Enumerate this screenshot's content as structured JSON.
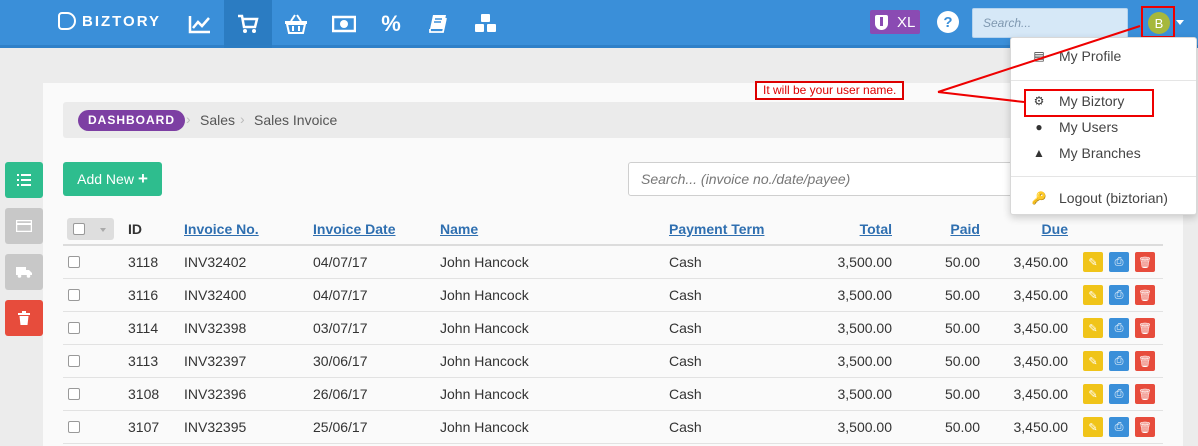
{
  "app": {
    "brand": "BIZTORY",
    "badge_label": "XL",
    "help_label": "?",
    "search_placeholder": "Search...",
    "avatar_initial": "B"
  },
  "nav_icons": [
    "chart-line-icon",
    "shopping-cart-icon",
    "basket-icon",
    "money-icon",
    "percent-icon",
    "book-icon",
    "cubes-icon"
  ],
  "dropdown": {
    "items": [
      {
        "label": "My Profile",
        "icon": "id-card-icon"
      },
      {
        "label": "My Biztory",
        "icon": "cogs-icon"
      },
      {
        "label": "My Users",
        "icon": "users-icon"
      },
      {
        "label": "My Branches",
        "icon": "sitemap-icon"
      },
      {
        "label": "Logout (biztorian)",
        "icon": "key-icon"
      }
    ]
  },
  "annotation": {
    "text": "It will be your user name.",
    "color": "#dd0000"
  },
  "breadcrumb": {
    "root": "DASHBOARD",
    "items": [
      "Sales",
      "Sales Invoice"
    ]
  },
  "toolbar": {
    "add_label": "Add New",
    "add_icon": "plus-icon",
    "search_placeholder": "Search... (invoice no./date/payee)"
  },
  "table": {
    "columns": [
      "ID",
      "Invoice No.",
      "Invoice Date",
      "Name",
      "Payment Term",
      "Total",
      "Paid",
      "Due"
    ],
    "rows": [
      {
        "id": "3118",
        "invoice": "INV32402",
        "date": "04/07/17",
        "name": "John Hancock",
        "term": "Cash",
        "total": "3,500.00",
        "paid": "50.00",
        "due": "3,450.00"
      },
      {
        "id": "3116",
        "invoice": "INV32400",
        "date": "04/07/17",
        "name": "John Hancock",
        "term": "Cash",
        "total": "3,500.00",
        "paid": "50.00",
        "due": "3,450.00"
      },
      {
        "id": "3114",
        "invoice": "INV32398",
        "date": "03/07/17",
        "name": "John Hancock",
        "term": "Cash",
        "total": "3,500.00",
        "paid": "50.00",
        "due": "3,450.00"
      },
      {
        "id": "3113",
        "invoice": "INV32397",
        "date": "30/06/17",
        "name": "John Hancock",
        "term": "Cash",
        "total": "3,500.00",
        "paid": "50.00",
        "due": "3,450.00"
      },
      {
        "id": "3108",
        "invoice": "INV32396",
        "date": "26/06/17",
        "name": "John Hancock",
        "term": "Cash",
        "total": "3,500.00",
        "paid": "50.00",
        "due": "3,450.00"
      },
      {
        "id": "3107",
        "invoice": "INV32395",
        "date": "25/06/17",
        "name": "John Hancock",
        "term": "Cash",
        "total": "3,500.00",
        "paid": "50.00",
        "due": "3,450.00"
      }
    ]
  },
  "side_actions": [
    {
      "icon": "list-icon",
      "color": "#2ebd8e"
    },
    {
      "icon": "credit-card-icon",
      "color": "#c8c8c8"
    },
    {
      "icon": "truck-icon",
      "color": "#c8c8c8"
    },
    {
      "icon": "trash-icon",
      "color": "#e74c3c"
    }
  ],
  "colors": {
    "topbar": "#3a8fd9",
    "accent_green": "#2ebd8e",
    "breadcrumb_pill": "#7d3fa3",
    "badge_purple": "#8a4bb3",
    "edit": "#f0c419",
    "print": "#3a8fd9",
    "delete": "#e74c3c"
  }
}
